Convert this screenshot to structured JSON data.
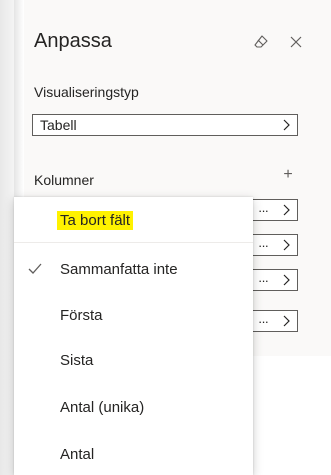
{
  "pane": {
    "title": "Anpassa",
    "icons": {
      "eraser": "eraser-icon",
      "close": "close-icon"
    },
    "visualization": {
      "label": "Visualiseringstyp",
      "value": "Tabell"
    },
    "columns": {
      "label": "Kolumner",
      "add_symbol": "+",
      "more_symbol": "···",
      "rows": 4
    }
  },
  "context_menu": {
    "items": [
      {
        "label": "Ta bort fält",
        "highlighted": true,
        "checked": false
      },
      {
        "label": "Sammanfatta inte",
        "highlighted": false,
        "checked": true
      },
      {
        "label": "Första",
        "highlighted": false,
        "checked": false
      },
      {
        "label": "Sista",
        "highlighted": false,
        "checked": false
      },
      {
        "label": "Antal (unika)",
        "highlighted": false,
        "checked": false
      },
      {
        "label": "Antal",
        "highlighted": false,
        "checked": false
      }
    ]
  },
  "colors": {
    "highlight": "#fff200",
    "pane_bg": "#faf9f8",
    "text": "#252423"
  }
}
